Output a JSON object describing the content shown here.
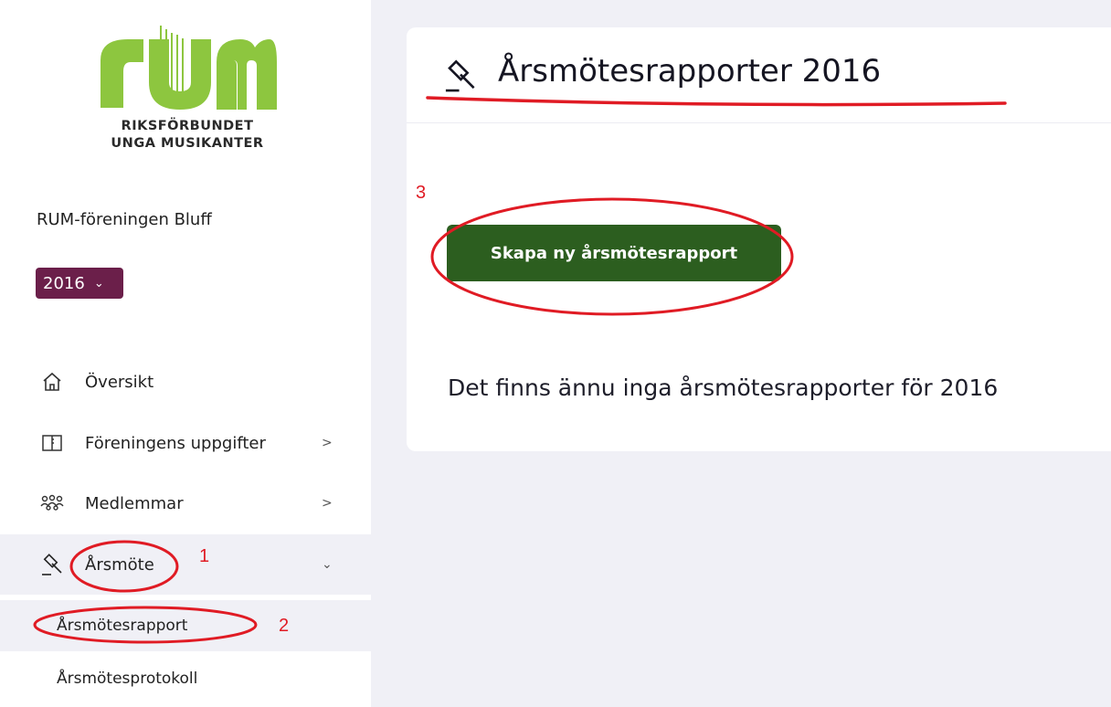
{
  "logo": {
    "brand_letters": "RUM",
    "line1": "RIKSFÖRBUNDET",
    "line2": "UNGA MUSIKANTER",
    "colors": {
      "green": "#8dc63f",
      "text": "#2a2a2a"
    }
  },
  "org": {
    "name": "RUM-föreningen Bluff"
  },
  "year_select": {
    "value": "2016",
    "icon": "chevron-down-icon",
    "color": "#6b1f4a"
  },
  "nav": {
    "items": [
      {
        "label": "Översikt",
        "icon": "home-icon",
        "arrow": ""
      },
      {
        "label": "Föreningens uppgifter",
        "icon": "book-icon",
        "arrow": ">"
      },
      {
        "label": "Medlemmar",
        "icon": "members-icon",
        "arrow": ">"
      },
      {
        "label": "Årsmöte",
        "icon": "gavel-icon",
        "arrow": "⌄"
      }
    ],
    "sub_items": [
      {
        "label": "Årsmötesrapport"
      },
      {
        "label": "Årsmötesprotokoll"
      }
    ]
  },
  "main": {
    "title": "Årsmötesrapporter 2016",
    "title_icon": "gavel-icon",
    "create_button_label": "Skapa ny årsmötesrapport",
    "empty_message": "Det finns ännu inga årsmötesrapporter för 2016",
    "button_color": "#2c5e1f"
  },
  "annotations": {
    "color": "#e01b24",
    "labels": [
      "1",
      "2",
      "3"
    ]
  }
}
